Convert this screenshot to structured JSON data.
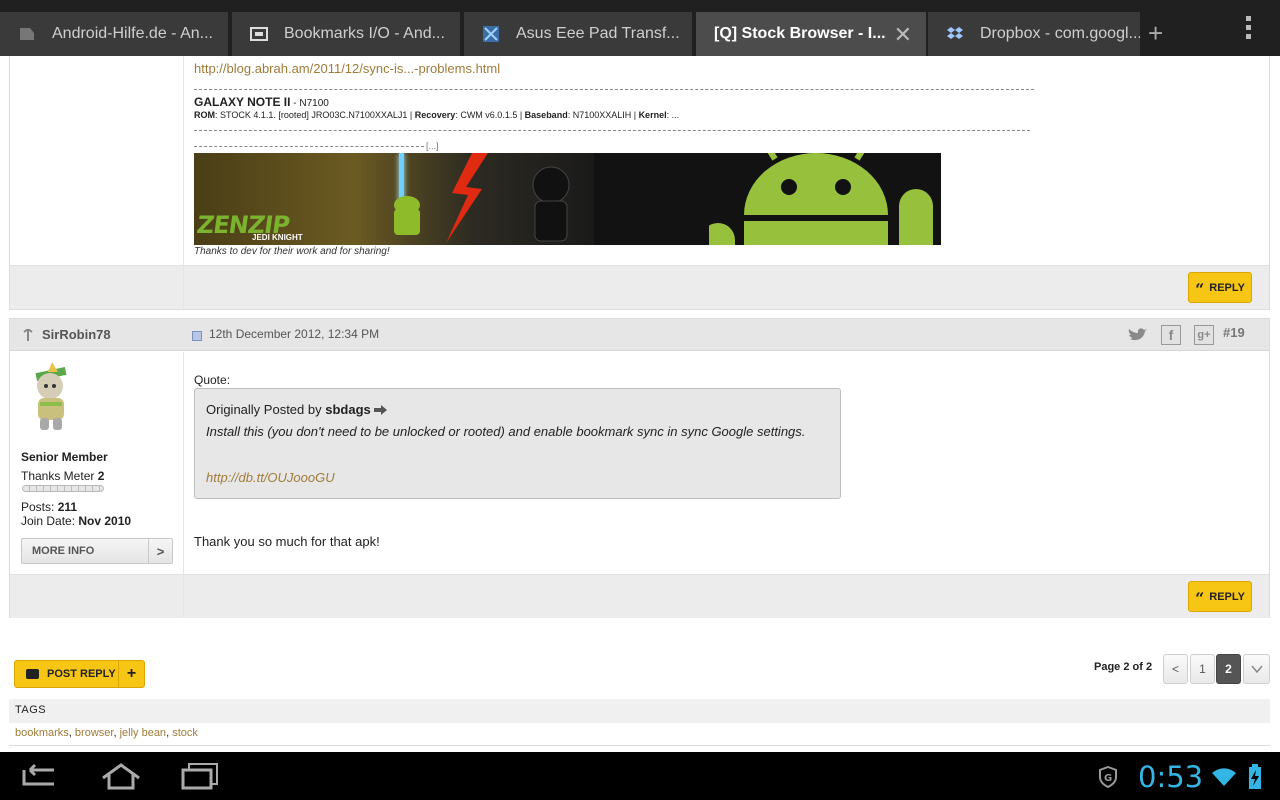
{
  "tabs": [
    {
      "title": "Android-Hilfe.de - An...",
      "favicon": "android-hilfe-icon"
    },
    {
      "title": "Bookmarks I/O - And...",
      "favicon": "bookmarks-io-icon"
    },
    {
      "title": "Asus Eee Pad Transf...",
      "favicon": "xda-icon"
    },
    {
      "title": "[Q] Stock Browser - I...",
      "favicon": "none",
      "active": true
    },
    {
      "title": "Dropbox - com.googl...",
      "favicon": "dropbox-icon"
    }
  ],
  "prev_post": {
    "sig_link": "http://blog.abrah.am/2011/12/sync-is...-problems.html",
    "device_name": "GALAXY NOTE II",
    "device_model": " - N7100",
    "rom_label": "ROM",
    "rom_value": ": STOCK 4.1.1. [rooted] JRO03C.N7100XXALJ1 | ",
    "recovery_label": "Recovery",
    "recovery_value": ": CWM v6.0.1.5 | ",
    "baseband_label": "Baseband",
    "baseband_value": ": N7100XXALIH | ",
    "kernel_label": "Kernel",
    "kernel_value": ": ...",
    "truncated": "[...]",
    "banner_text": "ZENZIP",
    "banner_subtext": "JEDI KNIGHT",
    "thanks_note": "Thanks to dev for their work and for sharing!",
    "reply_label": "REPLY"
  },
  "post": {
    "username": "SirRobin78",
    "date": "12th December 2012, 12:34 PM",
    "number": "#19",
    "rank": "Senior Member",
    "thanks_meter_label": "Thanks Meter",
    "thanks_meter_value": "2",
    "posts_label": "Posts:",
    "posts_value": "211",
    "join_label": "Join Date:",
    "join_value": "Nov 2010",
    "more_info": "MORE INFO",
    "more_info_arrow": ">",
    "quote_label": "Quote:",
    "quote_prefix": "Originally Posted by",
    "quote_author": "sbdags",
    "quote_text": "Install this (you don't need to be unlocked or rooted) and enable bookmark sync in sync Google settings.",
    "quote_link": "http://db.tt/OUJoooGU",
    "body": "Thank you so much for that apk!",
    "reply_label": "REPLY"
  },
  "footer": {
    "post_reply": "POST REPLY",
    "post_reply_plus": "+",
    "page_label": "Page 2 of 2",
    "pager": [
      "<",
      "1",
      "2"
    ],
    "current_page": "2",
    "tags_heading": "TAGS",
    "tags": [
      "bookmarks",
      "browser",
      "jelly bean",
      "stock"
    ]
  },
  "status": {
    "clock": "0:53"
  },
  "colors": {
    "accent": "#f7c514",
    "link": "#a07b38",
    "clock": "#33b5e5"
  }
}
